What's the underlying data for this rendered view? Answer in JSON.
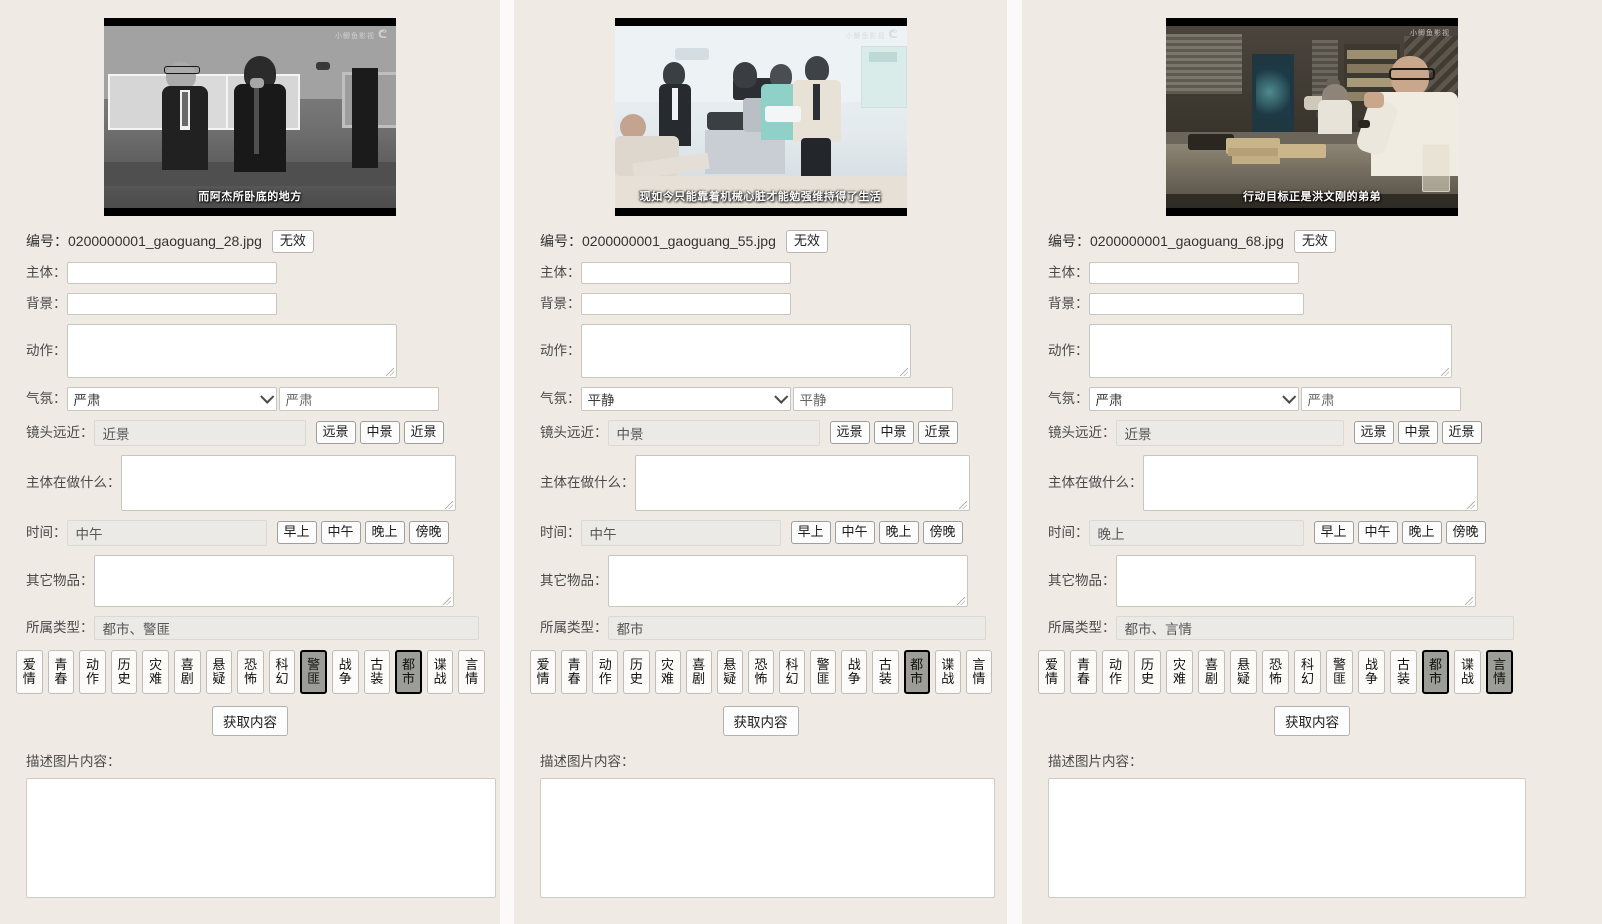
{
  "labels": {
    "id": "编号：",
    "subject": "主体：",
    "background": "背景：",
    "action": "动作：",
    "mood": "气氛：",
    "shot_distance": "镜头远近：",
    "subject_doing": "主体在做什么：",
    "time": "时间：",
    "other_items": "其它物品：",
    "genre": "所属类型：",
    "describe": "描述图片内容："
  },
  "buttons": {
    "invalid": "无效",
    "get_content": "获取内容",
    "shot_options": [
      "远景",
      "中景",
      "近景"
    ],
    "time_options": [
      "早上",
      "中午",
      "晚上",
      "傍晚"
    ]
  },
  "genre_tags": [
    "爱情",
    "青春",
    "动作",
    "历史",
    "灾难",
    "喜剧",
    "悬疑",
    "恐怖",
    "科幻",
    "警匪",
    "战争",
    "古装",
    "都市",
    "谍战",
    "言情"
  ],
  "panels": [
    {
      "filename": "0200000001_gaoguang_28.jpg",
      "subtitle": "而阿杰所卧底的地方",
      "watermark": "小鲫鱼影视",
      "watermark_logo": "bilibili",
      "subject": "",
      "background": "",
      "action": "",
      "mood_select": "严肃",
      "mood_text": "严肃",
      "shot_distance": "近景",
      "subject_doing": "",
      "time": "中午",
      "other_items": "",
      "genre_text": "都市、警匪",
      "selected_genres": [
        "警匪",
        "都市"
      ],
      "description": ""
    },
    {
      "filename": "0200000001_gaoguang_55.jpg",
      "subtitle": "现如今只能靠着机械心脏才能勉强维持得了生活",
      "watermark": "小鲫鱼影视",
      "watermark_logo": "bilibili",
      "subject": "",
      "background": "",
      "action": "",
      "mood_select": "平静",
      "mood_text": "平静",
      "shot_distance": "中景",
      "subject_doing": "",
      "time": "中午",
      "other_items": "",
      "genre_text": "都市",
      "selected_genres": [
        "都市"
      ],
      "description": ""
    },
    {
      "filename": "0200000001_gaoguang_68.jpg",
      "subtitle": "行动目标正是洪文刚的弟弟",
      "watermark": "小鲫鱼影视",
      "watermark_logo": "bilibili",
      "subject": "",
      "background": "",
      "action": "",
      "mood_select": "严肃",
      "mood_text": "严肃",
      "shot_distance": "近景",
      "subject_doing": "",
      "time": "晚上",
      "other_items": "",
      "genre_text": "都市、言情",
      "selected_genres": [
        "都市",
        "言情"
      ],
      "description": ""
    }
  ],
  "colors": {
    "panel_bg": "#efeae3",
    "page_bg": "#fbfaf8",
    "selected_tag_bg": "#9d9d98",
    "input_bg": "#ffffff",
    "readonly_bg": "#eceae6"
  }
}
